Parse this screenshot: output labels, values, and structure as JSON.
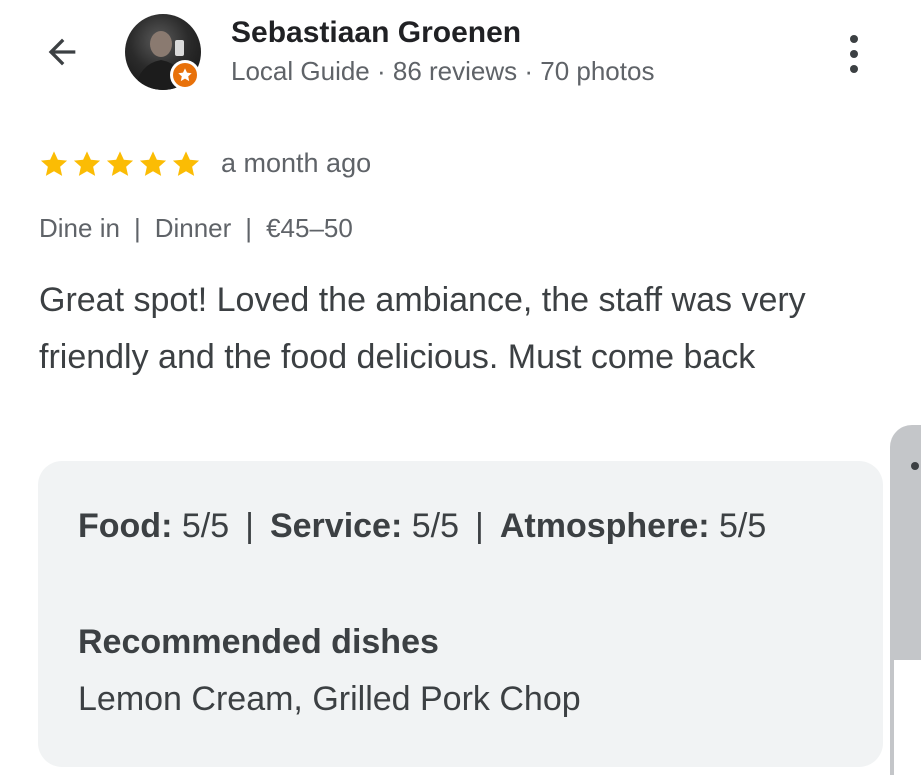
{
  "reviewer": {
    "name": "Sebastiaan Groenen",
    "meta": "Local Guide · 86 reviews · 70 photos"
  },
  "review": {
    "rating_stars": 5,
    "star_color": "#fbbc04",
    "time_ago": "a month ago",
    "visit_info": [
      "Dine in",
      "Dinner",
      "€45–50"
    ],
    "text": "Great spot! Loved the ambiance, the staff was very friendly and the food delicious. Must come back"
  },
  "details": {
    "ratings": [
      {
        "label": "Food:",
        "value": "5/5"
      },
      {
        "label": "Service:",
        "value": "5/5"
      },
      {
        "label": "Atmosphere:",
        "value": "5/5"
      }
    ],
    "recommended_title": "Recommended dishes",
    "recommended_dishes": "Lemon Cream, Grilled Pork Chop"
  },
  "separator": "|",
  "icons": {
    "back": "arrow-back-icon",
    "more": "more-vert-icon",
    "badge": "local-guide-badge-icon",
    "star": "star-icon"
  },
  "colors": {
    "badge": "#e8710a",
    "card_background": "#f1f3f4"
  }
}
